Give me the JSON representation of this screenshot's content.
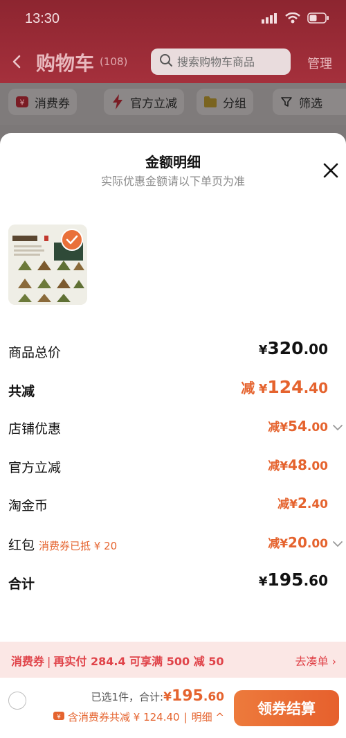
{
  "status_bar": {
    "time": "13:30"
  },
  "header": {
    "title": "购物车",
    "count": "(108)",
    "search_placeholder": "搜索购物车商品",
    "manage_label": "管理"
  },
  "filters": {
    "items": [
      {
        "label": "消费券",
        "icon": "coupon-icon"
      },
      {
        "label": "官方立减",
        "icon": "lightning-icon"
      },
      {
        "label": "分组",
        "icon": "folder-icon"
      },
      {
        "label": "筛选",
        "icon": "filter-icon"
      }
    ]
  },
  "sheet": {
    "title": "金额明细",
    "subtitle": "实际优惠金额请以下单页为准",
    "product": {
      "checked": true
    },
    "rows": {
      "total_price": {
        "label": "商品总价",
        "pre": "¥",
        "int": "320",
        "dec": ".00"
      },
      "total_reduce": {
        "label": "共减",
        "prefix": "减",
        "pre": "¥",
        "int": "124",
        "dec": ".40"
      },
      "store": {
        "label": "店铺优惠",
        "prefix": "减",
        "pre": "¥",
        "int": "54",
        "dec": ".00"
      },
      "official": {
        "label": "官方立减",
        "prefix": "减",
        "pre": "¥",
        "int": "48",
        "dec": ".00"
      },
      "coins": {
        "label": "淘金币",
        "prefix": "减",
        "pre": "¥",
        "int": "2",
        "dec": ".40"
      },
      "redpack": {
        "label": "红包",
        "note": "消费券已抵 ¥ 20",
        "prefix": "减",
        "pre": "¥",
        "int": "20",
        "dec": ".00"
      },
      "sum": {
        "label": "合计",
        "pre": "¥",
        "int": "195",
        "dec": ".60"
      }
    }
  },
  "promo": {
    "tag": "消费券",
    "text": "再实付 284.4 可享满 500 减 50",
    "action": "去凑单 ›"
  },
  "checkout": {
    "selected_text": "已选1件，合计:",
    "total_pre": "¥",
    "total_int": "195",
    "total_dec": ".60",
    "coupon_text": "含消费券共减 ¥ 124.40",
    "detail_text": "明细 ^",
    "button_label": "领券结算"
  },
  "colors": {
    "accent": "#e5632e",
    "header_bg": "#a5303c",
    "promo_text": "#e0444a",
    "promo_bg": "#fbe7e5"
  }
}
